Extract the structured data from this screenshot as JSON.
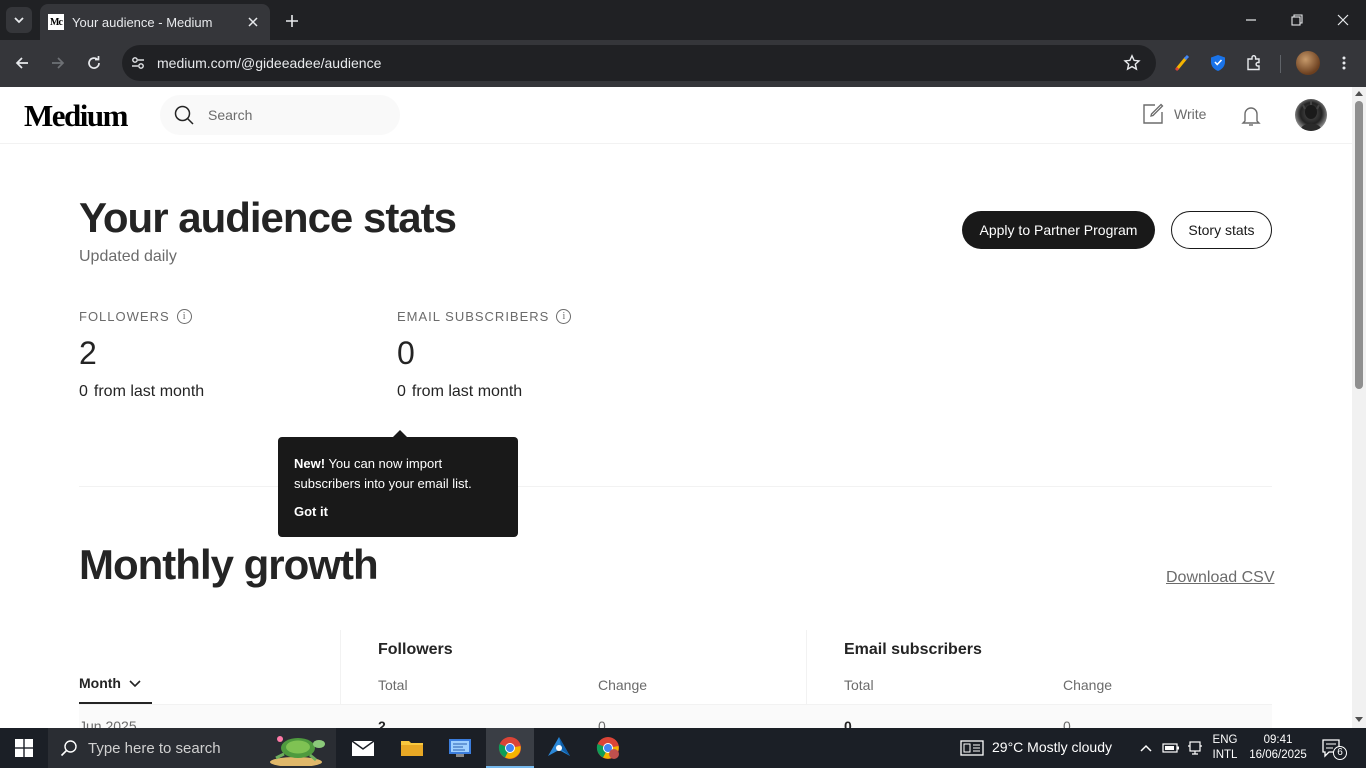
{
  "browser": {
    "tab_title": "Your audience - Medium",
    "favicon_text": "Mc",
    "url": "medium.com/@gideeadee/audience"
  },
  "medium": {
    "logo": "Medium",
    "search_placeholder": "Search",
    "write_label": "Write"
  },
  "page": {
    "title": "Your audience stats",
    "subtitle": "Updated daily",
    "partner_button": "Apply to Partner Program",
    "story_stats_button": "Story stats"
  },
  "stats": {
    "followers": {
      "label": "FOLLOWERS",
      "value": "2",
      "change": "0",
      "change_suffix": "from last month"
    },
    "email_subscribers": {
      "label": "EMAIL SUBSCRIBERS",
      "value": "0",
      "change": "0",
      "change_suffix": "from last month"
    },
    "info_glyph": "i"
  },
  "tooltip": {
    "bold": "New!",
    "text": " You can now import subscribers into your email list.",
    "action": "Got it"
  },
  "growth": {
    "title": "Monthly growth",
    "download_label": "Download CSV",
    "month_header": "Month",
    "followers_header": "Followers",
    "email_header": "Email subscribers",
    "total_header": "Total",
    "change_header": "Change",
    "rows": [
      {
        "month": "Jun 2025",
        "followers_total": "2",
        "followers_change": "0",
        "email_total": "0",
        "email_change": "0"
      }
    ]
  },
  "taskbar": {
    "search_placeholder": "Type here to search",
    "weather": "29°C  Mostly cloudy",
    "lang_line1": "ENG",
    "lang_line2": "INTL",
    "time": "09:41",
    "date": "16/06/2025",
    "notification_count": "6"
  },
  "colors": {
    "chrome_dark": "#202124",
    "chrome_toolbar": "#35363a",
    "medium_text": "#242424",
    "medium_muted": "#6b6b6b",
    "button_dark": "#191919",
    "taskbar_bg": "#1b1f26"
  }
}
